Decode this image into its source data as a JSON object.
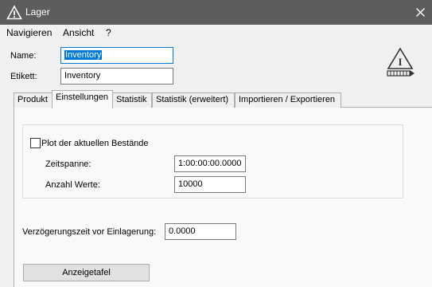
{
  "window": {
    "title": "Lager",
    "icon": "warning-triangle-icon",
    "close_icon": "close-icon"
  },
  "menu": {
    "items": [
      "Navigieren",
      "Ansicht",
      "?"
    ]
  },
  "form": {
    "name_label": "Name:",
    "name_value": "Inventory",
    "label_label": "Etikett:",
    "label_value": "Inventory"
  },
  "badge": {
    "icon": "storage-warning-icon",
    "glyph": "I"
  },
  "tabs": [
    {
      "label": "Produkt",
      "active": false
    },
    {
      "label": "Einstellungen",
      "active": true
    },
    {
      "label": "Statistik",
      "active": false
    },
    {
      "label": "Statistik (erweitert)",
      "active": false
    },
    {
      "label": "Importieren / Exportieren",
      "active": false
    }
  ],
  "settings": {
    "plot_checkbox_label": "Plot der aktuellen Bestände",
    "plot_checked": false,
    "timespan_label": "Zeitspanne:",
    "timespan_value": "1:00:00:00.0000",
    "count_label": "Anzahl Werte:",
    "count_value": "10000",
    "delay_label": "Verzögerungszeit vor Einlagerung:",
    "delay_value": "0.0000",
    "display_button_label": "Anzeigetafel"
  },
  "colors": {
    "titlebar": "#5d5d5d",
    "selection": "#0078d7",
    "panel": "#f9f9f9"
  }
}
